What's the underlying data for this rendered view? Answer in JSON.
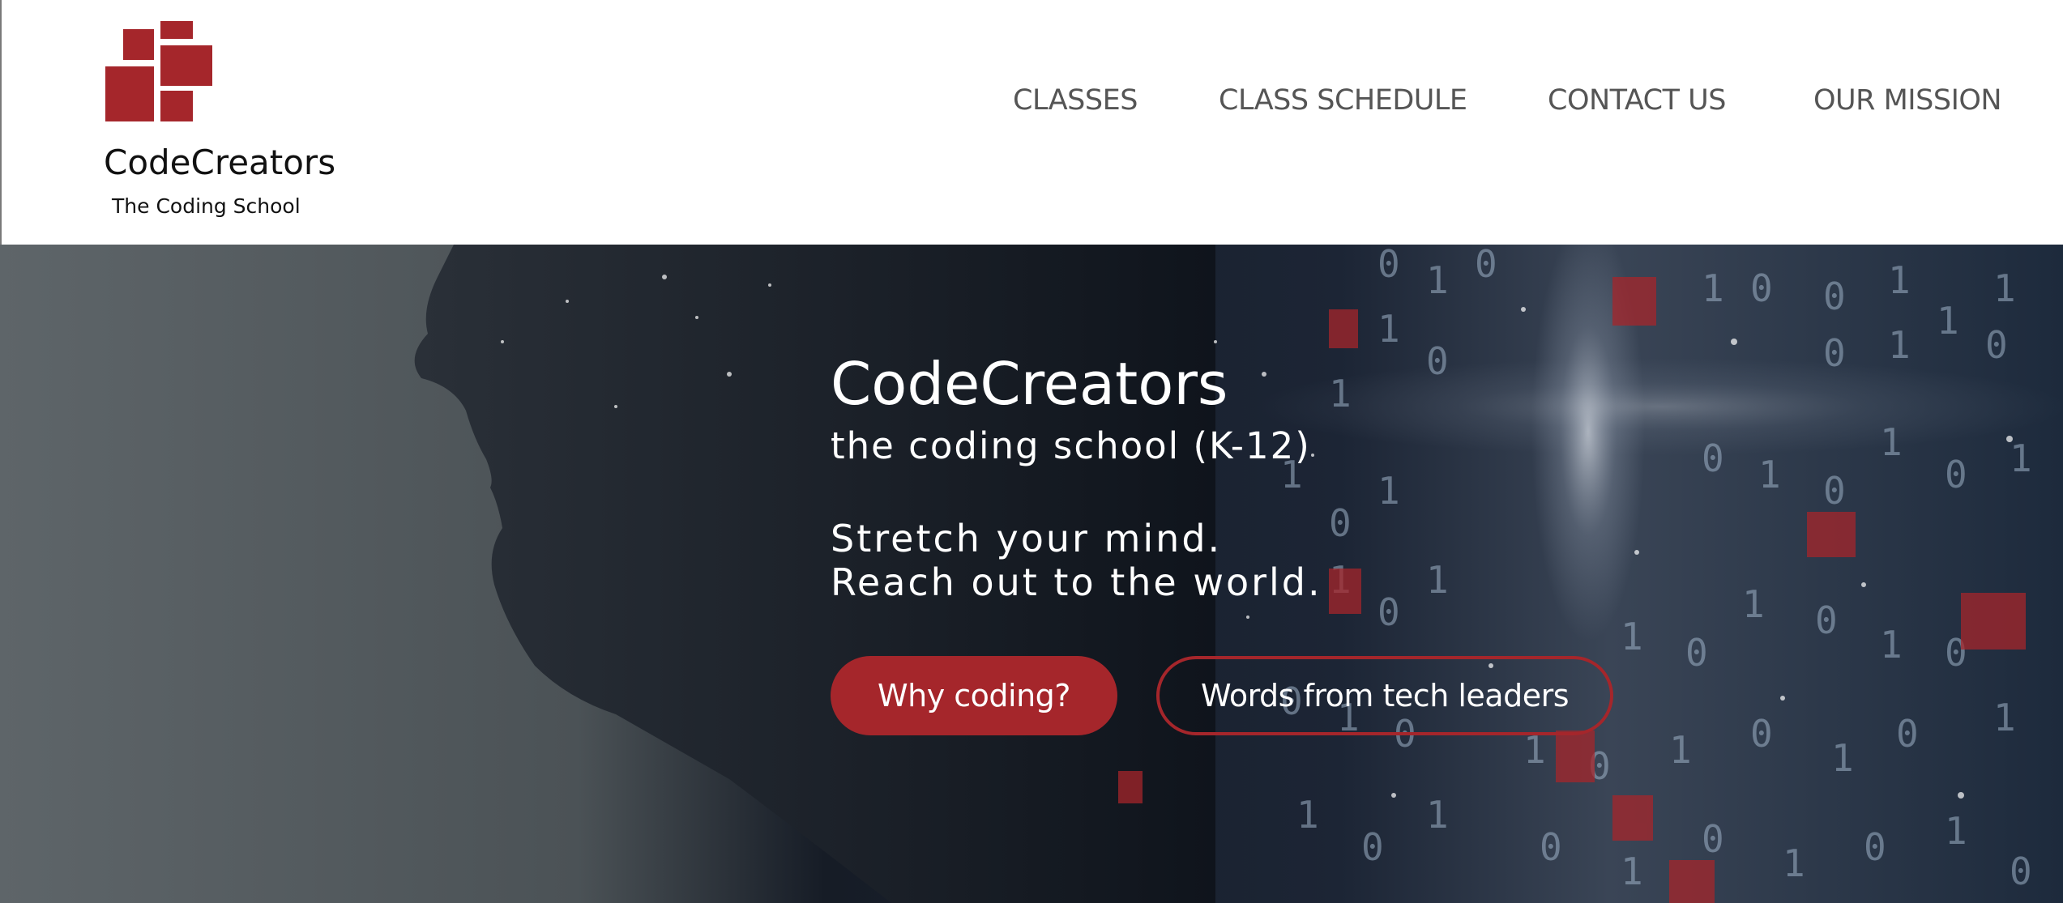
{
  "brand": {
    "name": "CodeCreators",
    "tagline": "The Coding School",
    "accent_color": "#a5262b"
  },
  "nav": {
    "items": [
      {
        "label": "CLASSES"
      },
      {
        "label": "CLASS SCHEDULE"
      },
      {
        "label": "CONTACT US"
      },
      {
        "label": "OUR MISSION"
      }
    ]
  },
  "hero": {
    "title": "CodeCreators",
    "subtitle": "the coding school (K-12)",
    "line1": "Stretch your mind.",
    "line2": "Reach out to the world.",
    "primary_button": "Why coding?",
    "secondary_button": "Words from tech leaders"
  }
}
